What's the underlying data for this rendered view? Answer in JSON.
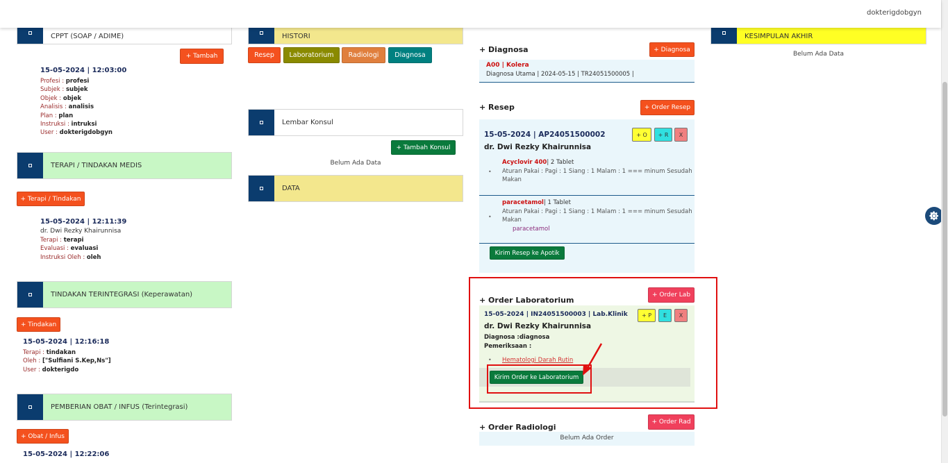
{
  "topbar": {
    "user": "dokterigdobgyn"
  },
  "col1": {
    "cppt": {
      "title": "CPPT (SOAP / ADIME)",
      "add_label": "+ Tambah",
      "entry": {
        "time": "15-05-2024 | 12:03:00",
        "rows": [
          {
            "k": "Profesi : ",
            "v": "profesi"
          },
          {
            "k": "Subjek : ",
            "v": "subjek"
          },
          {
            "k": "Objek : ",
            "v": "objek"
          },
          {
            "k": "Analisis : ",
            "v": "analisis"
          },
          {
            "k": "Plan : ",
            "v": "plan"
          },
          {
            "k": "Instruksi : ",
            "v": "intruksi"
          },
          {
            "k": "User : ",
            "v": "dokterigdobgyn"
          }
        ]
      }
    },
    "terapi": {
      "title": "TERAPI / TINDAKAN MEDIS",
      "add_label": "+ Terapi / Tindakan",
      "entry": {
        "time": "15-05-2024 | 12:11:39",
        "doctor": "dr. Dwi Rezky Khairunnisa",
        "rows": [
          {
            "k": "Terapi : ",
            "v": "terapi"
          },
          {
            "k": "Evaluasi : ",
            "v": "evaluasi"
          },
          {
            "k": "Instruksi Oleh : ",
            "v": "oleh"
          }
        ]
      }
    },
    "tindakan": {
      "title": "TINDAKAN TERINTEGRASI (Keperawatan)",
      "add_label": "+ Tindakan",
      "entry": {
        "time": "15-05-2024 | 12:16:18",
        "rows": [
          {
            "k": "Terapi : ",
            "v": "tindakan"
          },
          {
            "k": "Oleh : ",
            "v": "[\"Sulfiani S.Kep,Ns\"]"
          },
          {
            "k": "User : ",
            "v": "dokterigdo"
          }
        ]
      }
    },
    "obat": {
      "title": "PEMBERIAN OBAT / INFUS (Terintegrasi)",
      "add_label": "+ Obat / Infus",
      "entry": {
        "time": "15-05-2024 | 12:22:06"
      }
    }
  },
  "col2": {
    "histori": {
      "title": "HISTORI",
      "tabs": [
        "Resep",
        "Laboratorium",
        "Radiologi",
        "Diagnosa"
      ]
    },
    "konsul": {
      "title": "Lembar Konsul",
      "add_label": "+ Tambah Konsul",
      "empty": "Belum Ada Data"
    },
    "data": {
      "title": "DATA"
    }
  },
  "col3": {
    "diagnosa": {
      "title": "+ Diagnosa",
      "add_label": "+ Diagnosa",
      "code": "A00 | Kolera",
      "detail": "Diagnosa Utama | 2024-05-15 | TR24051500005 |"
    },
    "resep": {
      "title": "+ Resep",
      "add_label": "+ Order Resep",
      "header": "15-05-2024 | AP24051500002",
      "doctor": "dr. Dwi Rezky Khairunnisa",
      "mini": [
        "+ O",
        "+ R",
        "X"
      ],
      "items": [
        {
          "bullet": "•",
          "name": "Acyclovir 400",
          "qty": "| 2 Tablet",
          "rule": "Aturan Pakai : Pagi : 1 Siang : 1 Malam : 1 === minum Sesudah",
          "rule2": "Makan",
          "extra": ""
        },
        {
          "bullet": "•",
          "name": "paracetamol",
          "qty": "| 1 Tablet",
          "rule": "Aturan Pakai : Pagi : 1 Siang : 1 Malam : 1 === minum Sesudah",
          "rule2": "Makan",
          "extra": "paracetamol"
        }
      ],
      "send_label": "Kirim Resep ke Apotik"
    },
    "lab": {
      "title": "+ Order Laboratorium",
      "add_label": "+ Order Lab",
      "header": "15-05-2024 | IN24051500003 | Lab.Klinik",
      "doctor": "dr. Dwi Rezky Khairunnisa",
      "mini": [
        "+ P",
        "E",
        "X"
      ],
      "diagnosa": "Diagnosa :diagnosa",
      "pemeriksaan": "Pemeriksaan :",
      "bullet": "•",
      "item": "Hematologi Darah Rutin",
      "send_label": "Kirim Order ke Laboratorium"
    },
    "rad": {
      "title": "+ Order Radiologi",
      "add_label": "+ Order Rad",
      "empty": "Belum Ada Order"
    }
  },
  "col4": {
    "title": "KESIMPULAN AKHIR",
    "empty": "Belum Ada Data"
  },
  "colors": {
    "navy": "#0b3c6e",
    "green_header": "#c8f7c5",
    "yellow_header": "#f3e78d",
    "orange_button": "#f4511e",
    "highlight": "#e01010"
  }
}
